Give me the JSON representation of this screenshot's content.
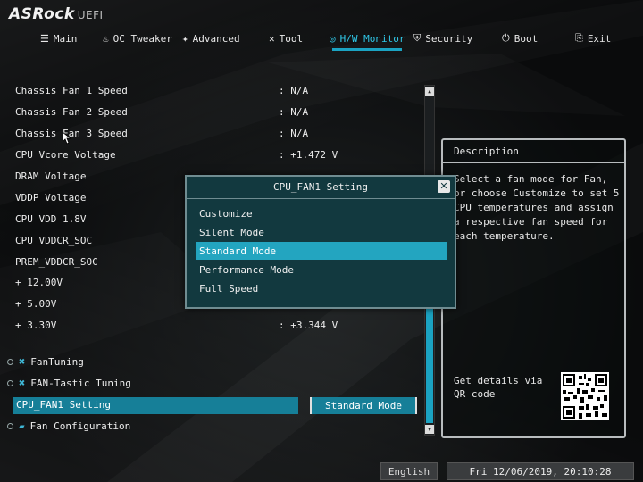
{
  "brand": {
    "name": "ASRock",
    "suffix": "UEFI"
  },
  "nav": {
    "items": [
      {
        "icon": "list-icon",
        "label": "Main"
      },
      {
        "icon": "flame-icon",
        "label": "OC Tweaker"
      },
      {
        "icon": "star-icon",
        "label": "Advanced"
      },
      {
        "icon": "wrench-icon",
        "label": "Tool"
      },
      {
        "icon": "monitor-icon",
        "label": "H/W Monitor",
        "active": true
      },
      {
        "icon": "shield-icon",
        "label": "Security"
      },
      {
        "icon": "power-icon",
        "label": "Boot"
      },
      {
        "icon": "exit-icon",
        "label": "Exit"
      }
    ]
  },
  "readings": [
    {
      "label": "Chassis Fan 1 Speed",
      "value": ": N/A"
    },
    {
      "label": "Chassis Fan 2 Speed",
      "value": ": N/A"
    },
    {
      "label": "Chassis Fan 3 Speed",
      "value": ": N/A"
    },
    {
      "label": "CPU Vcore Voltage",
      "value": ": +1.472 V"
    },
    {
      "label": "DRAM Voltage",
      "value": ""
    },
    {
      "label": "VDDP Voltage",
      "value": ""
    },
    {
      "label": "CPU VDD 1.8V",
      "value": ""
    },
    {
      "label": "CPU VDDCR_SOC",
      "value": ""
    },
    {
      "label": "PREM_VDDCR_SOC",
      "value": ""
    },
    {
      "label": "+ 12.00V",
      "value": ""
    },
    {
      "label": "+ 5.00V",
      "value": ""
    },
    {
      "label": "+ 3.30V",
      "value": ": +3.344 V"
    }
  ],
  "menu": {
    "fantuning": "FanTuning",
    "fantastic": "FAN-Tastic Tuning",
    "cpu_fan1": "CPU_FAN1 Setting",
    "cpu_fan1_value": "Standard Mode",
    "fan_config": "Fan Configuration"
  },
  "description": {
    "title": "Description",
    "text": "Select a fan mode for Fan, or choose Customize to set 5 CPU temperatures and assign a respective fan speed for each temperature.",
    "qr_label": "Get details via QR code"
  },
  "modal": {
    "title": "CPU_FAN1 Setting",
    "close_icon": "close-icon",
    "options": [
      "Customize",
      "Silent Mode",
      "Standard Mode",
      "Performance Mode",
      "Full Speed"
    ],
    "selected": "Standard Mode"
  },
  "footer": {
    "language": "English",
    "datetime": "Fri 12/06/2019, 20:10:28"
  },
  "colors": {
    "accent": "#1ba3c2",
    "selection": "#23a5c0",
    "modal_bg": "#12393f"
  }
}
